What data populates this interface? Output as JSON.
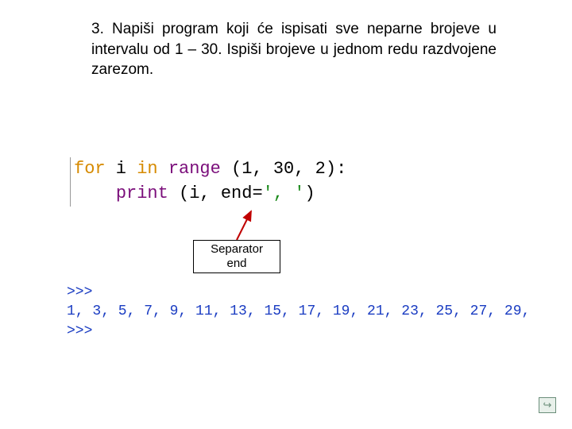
{
  "task": "3. Napiši program koji će ispisati sve neparne brojeve u intervalu od 1 – 30. Ispiši brojeve u jednom redu razdvojene zarezom.",
  "code": {
    "kw_for": "for",
    "var_line": " i ",
    "kw_in": "in",
    "fn_range": " range ",
    "range_args": "(1, 30, 2)",
    "colon": ":",
    "indent": "    ",
    "fn_print": "print ",
    "print_args_open": "(i, end=",
    "print_str": "', '",
    "print_args_close": ")"
  },
  "label": {
    "line1": "Separator",
    "line2": "end"
  },
  "output": {
    "prompt1": ">>> ",
    "result": "1, 3, 5, 7, 9, 11, 13, 15, 17, 19, 21, 23, 25, 27, 29,",
    "prompt2": ">>> "
  },
  "nav": "↪"
}
